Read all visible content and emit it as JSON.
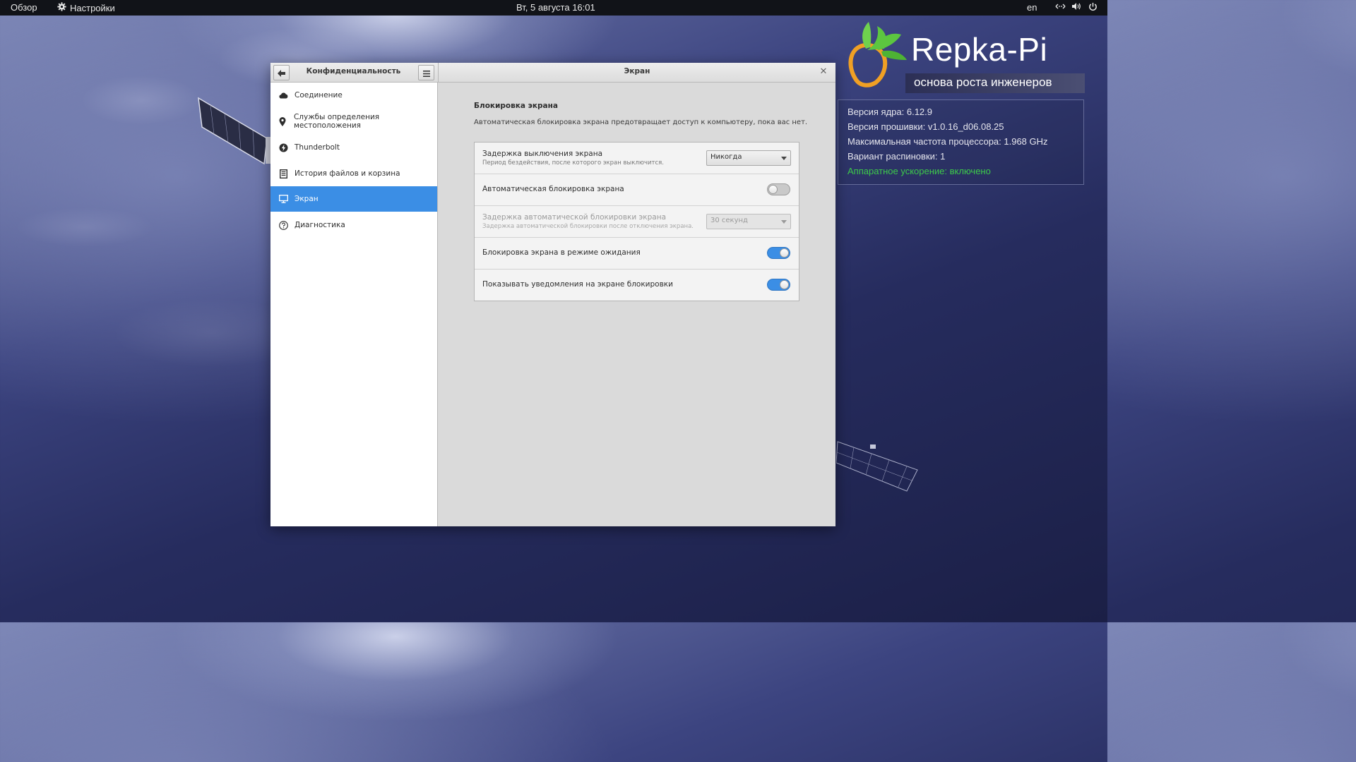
{
  "topbar": {
    "overview": "Обзор",
    "app_name": "Настройки",
    "clock": "Вт, 5 августа  16:01",
    "lang": "en"
  },
  "logo": {
    "title": "Repka-Pi",
    "subtitle": "основа роста инженеров"
  },
  "info": {
    "kernel": "Версия ядра: 6.12.9",
    "firmware": "Версия прошивки: v1.0.16_d06.08.25",
    "cpu_freq": "Максимальная частота процессора: 1.968 GHz",
    "pinout": "Вариант распиновки: 1",
    "accel": "Аппаратное ускорение: включено",
    "accel_color": "#3dca4a"
  },
  "window": {
    "sidebar_title": "Конфиденциальность",
    "panel_title": "Экран",
    "sidebar_items": [
      {
        "label": "Соединение",
        "icon": "cloud-icon"
      },
      {
        "label": "Службы определения местоположения",
        "icon": "location-pin-icon"
      },
      {
        "label": "Thunderbolt",
        "icon": "thunderbolt-icon"
      },
      {
        "label": "История файлов и корзина",
        "icon": "document-icon"
      },
      {
        "label": "Экран",
        "icon": "monitor-icon",
        "active": true
      },
      {
        "label": "Диагностика",
        "icon": "help-circle-icon"
      }
    ],
    "active_color": "#3b8ee5"
  },
  "screen_lock": {
    "title": "Блокировка экрана",
    "description": "Автоматическая блокировка экрана предотвращает доступ к компьютеру, пока вас нет.",
    "rows": [
      {
        "title": "Задержка выключения экрана",
        "subtitle": "Период бездействия, после которого экран выключится.",
        "control": "combo",
        "value": "Никогда"
      },
      {
        "title": "Автоматическая блокировка экрана",
        "control": "toggle",
        "state": "off"
      },
      {
        "title": "Задержка автоматической блокировки экрана",
        "subtitle": "Задержка автоматической блокировки после отключения экрана.",
        "control": "combo",
        "value": "30 секунд",
        "disabled": true
      },
      {
        "title": "Блокировка экрана в режиме ожидания",
        "control": "toggle",
        "state": "on"
      },
      {
        "title": "Показывать уведомления на экране блокировки",
        "control": "toggle",
        "state": "on"
      }
    ]
  }
}
